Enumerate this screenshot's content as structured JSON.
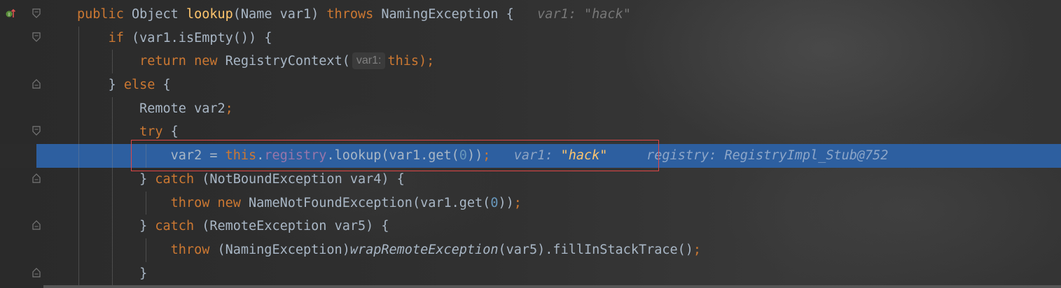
{
  "gutter": {
    "first_line_icon": "override-up-icon"
  },
  "code": {
    "l1": {
      "kw1": "public ",
      "type": "Object ",
      "fn": "lookup",
      "params": "(Name var1) ",
      "kw2": "throws ",
      "exc": "NamingException {",
      "hint_label": "var1: ",
      "hint_value": "\"hack\""
    },
    "l2": {
      "kw": "if ",
      "rest": "(var1.isEmpty()) {"
    },
    "l3": {
      "kw1": "return ",
      "kw2": "new ",
      "cls": "RegistryContext(",
      "chip": "var1:",
      "this_kw": "this",
      "end": ");"
    },
    "l4": {
      "brace": "} ",
      "kw": "else ",
      "rest": "{"
    },
    "l5": {
      "text": "Remote var2",
      "end": ";"
    },
    "l6": {
      "kw": "try ",
      "rest": "{"
    },
    "l7": {
      "a": "var2 = ",
      "this_kw": "this",
      "dot": ".",
      "fld": "registry",
      "b": ".lookup(var1.get(",
      "num": "0",
      "c": "))",
      "semi": ";",
      "hint1_label": "var1: ",
      "hint1_value": "\"hack\"",
      "hint2": "registry: RegistryImpl_Stub@752"
    },
    "l8": {
      "brace": "} ",
      "kw": "catch ",
      "rest": "(NotBoundException var4) {"
    },
    "l9": {
      "kw1": "throw ",
      "kw2": "new ",
      "rest": "NameNotFoundException(var1.get(",
      "num": "0",
      "end": "))",
      "semi": ";"
    },
    "l10": {
      "brace": "} ",
      "kw": "catch ",
      "rest": "(RemoteException var5) {"
    },
    "l11": {
      "kw": "throw ",
      "a": "(NamingException)",
      "it": "wrapRemoteException",
      "b": "(var5).fillInStackTrace()",
      "semi": ";"
    },
    "l12": {
      "brace": "}"
    }
  },
  "colors": {
    "keyword": "#cc7832",
    "method": "#ffc66d",
    "field": "#9876aa",
    "number": "#6897bb",
    "execution_line": "#2d5fa0",
    "highlight_box": "#e04646"
  }
}
